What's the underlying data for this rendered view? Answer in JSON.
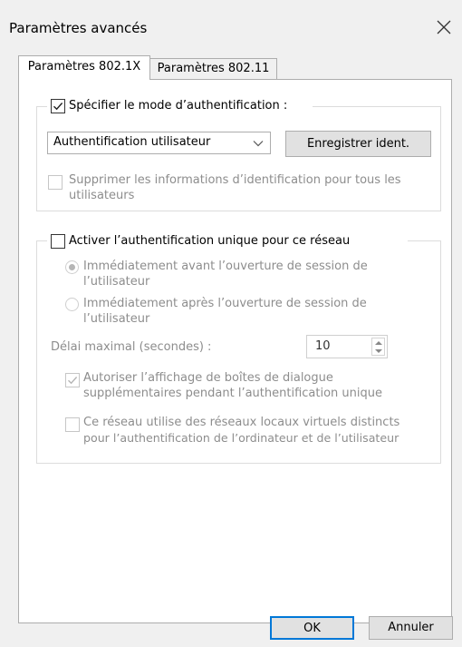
{
  "window": {
    "title": "Paramètres avancés"
  },
  "tabs": [
    {
      "label": "Paramètres 802.1X",
      "active": true
    },
    {
      "label": "Paramètres 802.11",
      "active": false
    }
  ],
  "auth_group": {
    "checkbox_label": "Spécifier le mode d’authentification :",
    "checked": true,
    "mode_select": {
      "value": "Authentification utilisateur"
    },
    "save_button_label": "Enregistrer ident.",
    "delete_creds_line1": "Supprimer les informations d’identification pour tous les",
    "delete_creds_line2": "utilisateurs",
    "delete_creds_checked": false
  },
  "sso_group": {
    "checkbox_label": "Activer l’authentification unique pour ce réseau",
    "checked": false,
    "radio_before_line1": "Immédiatement avant l’ouverture de session de",
    "radio_before_line2": "l’utilisateur",
    "radio_before_selected": true,
    "radio_after_line1": "Immédiatement après l’ouverture de session de",
    "radio_after_line2": "l’utilisateur",
    "radio_after_selected": false,
    "delay_label": "Délai maximal (secondes) :",
    "delay_value": "10",
    "allow_dialogs_line1": "Autoriser l’affichage de boîtes de dialogue",
    "allow_dialogs_line2": "supplémentaires pendant l’authentification unique",
    "allow_dialogs_checked": true,
    "vlan_line1": "Ce réseau utilise des réseaux locaux virtuels distincts",
    "vlan_line2": "pour l’authentification de l’ordinateur et de l’utilisateur",
    "vlan_checked": false
  },
  "footer": {
    "ok_label": "OK",
    "cancel_label": "Annuler"
  },
  "colors": {
    "ok_border": "#0078d7",
    "disabled_text": "#8d8d8d"
  }
}
